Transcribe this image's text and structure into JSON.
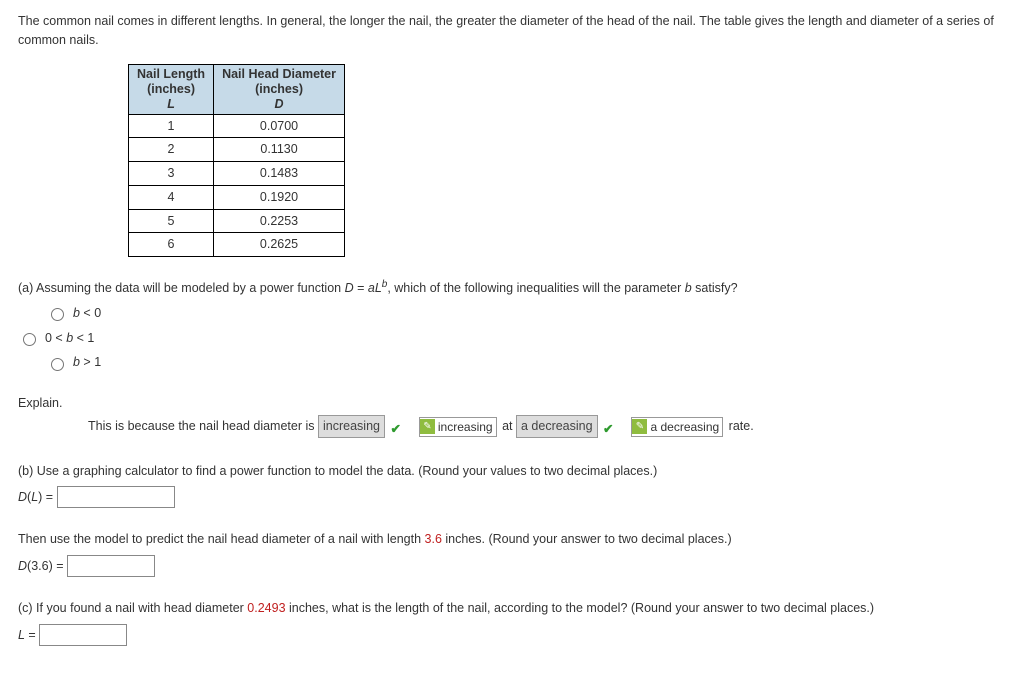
{
  "intro": "The common nail comes in different lengths. In general, the longer the nail, the greater the diameter of the head of the nail. The table gives the length and diameter of a series of common nails.",
  "table": {
    "header1_line1": "Nail Length",
    "header1_line2": "(inches)",
    "header1_var": "L",
    "header2_line1": "Nail Head Diameter",
    "header2_line2": "(inches)",
    "header2_var": "D",
    "rows": [
      {
        "L": "1",
        "D": "0.0700"
      },
      {
        "L": "2",
        "D": "0.1130"
      },
      {
        "L": "3",
        "D": "0.1483"
      },
      {
        "L": "4",
        "D": "0.1920"
      },
      {
        "L": "5",
        "D": "0.2253"
      },
      {
        "L": "6",
        "D": "0.2625"
      }
    ]
  },
  "partA": {
    "prompt_pre": "(a) Assuming the data will be modeled by a power function ",
    "prompt_post": ", which of the following inequalities will the parameter ",
    "prompt_end": " satisfy?",
    "eq_lhs": "D",
    "eq_mid": " = ",
    "eq_a": "a",
    "eq_L": "L",
    "eq_b": "b",
    "param": "b",
    "opt1": "b < 0",
    "opt2": "0 < b < 1",
    "opt3": "b > 1"
  },
  "explain_label": "Explain.",
  "explain_sentence": {
    "s1": "This is because the nail head diameter is ",
    "ans1": "increasing",
    "alt1": "increasing",
    "s2": " at ",
    "ans2": "a decreasing",
    "alt2": "a decreasing",
    "s3": " rate."
  },
  "partB": {
    "prompt": "(b) Use a graphing calculator to find a power function to model the data. (Round your values to two decimal places.)",
    "label": "D(L) = ",
    "then": "Then use the model to predict the nail head diameter of a nail with length ",
    "len_val": "3.6",
    "then2": " inches. (Round your answer to two decimal places.)",
    "label2": "D(3.6) = "
  },
  "partC": {
    "prompt1": "(c) If you found a nail with head diameter ",
    "diam_val": "0.2493",
    "prompt2": " inches, what is the length of the nail, according to the model? (Round your answer to two decimal places.)",
    "label": "L = "
  },
  "chart_data": {
    "type": "table",
    "columns": [
      "Nail Length (inches) L",
      "Nail Head Diameter (inches) D"
    ],
    "rows": [
      [
        1,
        0.07
      ],
      [
        2,
        0.113
      ],
      [
        3,
        0.1483
      ],
      [
        4,
        0.192
      ],
      [
        5,
        0.2253
      ],
      [
        6,
        0.2625
      ]
    ]
  }
}
